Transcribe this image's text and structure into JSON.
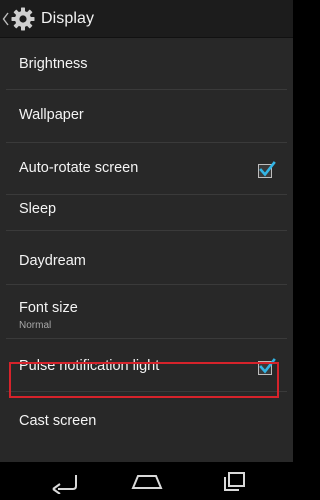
{
  "action_bar": {
    "title": "Display",
    "back_icon": "chevron-left-icon",
    "app_icon": "gear-icon"
  },
  "settings": [
    {
      "label": "Brightness"
    },
    {
      "label": "Wallpaper"
    },
    {
      "label": "Auto-rotate screen",
      "checked": true
    },
    {
      "label": "Sleep"
    },
    {
      "label": "Daydream"
    },
    {
      "label": "Font size",
      "summary": "Normal"
    },
    {
      "label": "Pulse notification light",
      "checked": true,
      "highlighted": true
    },
    {
      "label": "Cast screen"
    }
  ],
  "colors": {
    "checkmark": "#33b5e5",
    "highlight": "#d6232b",
    "background": "#282828"
  },
  "navigation_bar": {
    "back": "back-icon",
    "home": "home-icon",
    "recents": "recents-icon"
  }
}
